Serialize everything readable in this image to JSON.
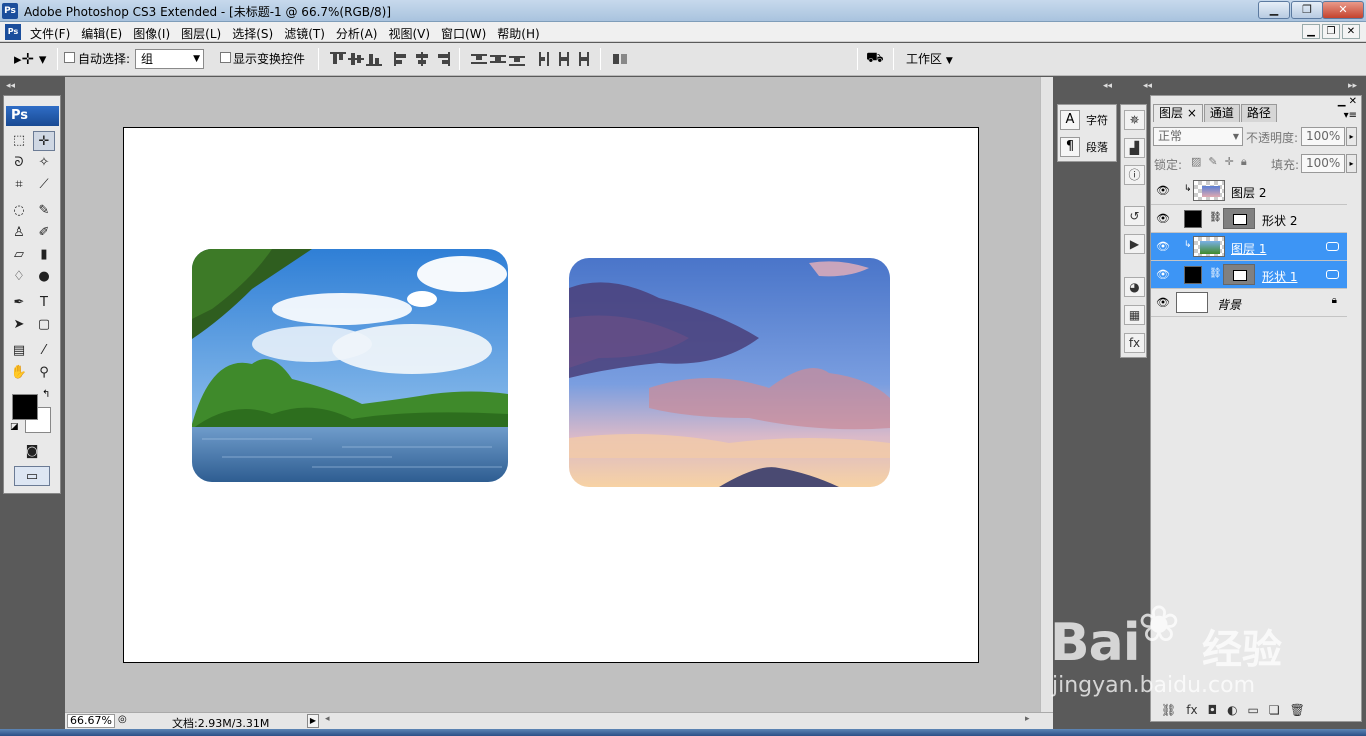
{
  "window": {
    "title": "Adobe Photoshop CS3 Extended - [未标题-1 @ 66.7%(RGB/8)]",
    "app_icon_text": "Ps"
  },
  "menu": {
    "items": [
      "文件(F)",
      "编辑(E)",
      "图像(I)",
      "图层(L)",
      "选择(S)",
      "滤镜(T)",
      "分析(A)",
      "视图(V)",
      "窗口(W)",
      "帮助(H)"
    ]
  },
  "options_bar": {
    "auto_select_label": "自动选择:",
    "auto_select_value": "组",
    "show_transform_label": "显示变换控件",
    "workspace_label": "工作区"
  },
  "toolbox": {
    "logo": "Ps",
    "foreground_color": "#000000",
    "background_color": "#ffffff"
  },
  "status": {
    "zoom": "66.67%",
    "doc_info": "文档:2.93M/3.31M"
  },
  "char_panel": {
    "character_label": "字符",
    "paragraph_label": "段落"
  },
  "layers_panel": {
    "tabs": [
      "图层",
      "通道",
      "路径"
    ],
    "blend_mode": "正常",
    "opacity_label": "不透明度:",
    "opacity_value": "100%",
    "lock_label": "锁定:",
    "fill_label": "填充:",
    "fill_value": "100%",
    "layers": [
      {
        "name": "图层 2",
        "selected": false
      },
      {
        "name": "形状 2",
        "selected": false
      },
      {
        "name": "图层 1",
        "selected": true
      },
      {
        "name": "形状 1",
        "selected": true
      },
      {
        "name": "背景",
        "selected": false
      }
    ]
  },
  "watermark": {
    "brand": "Bai",
    "brand_suffix": "经验",
    "url": "jingyan.baidu.com"
  },
  "colors": {
    "selection": "#3d95f5",
    "workspace": "#c0c0c0"
  }
}
